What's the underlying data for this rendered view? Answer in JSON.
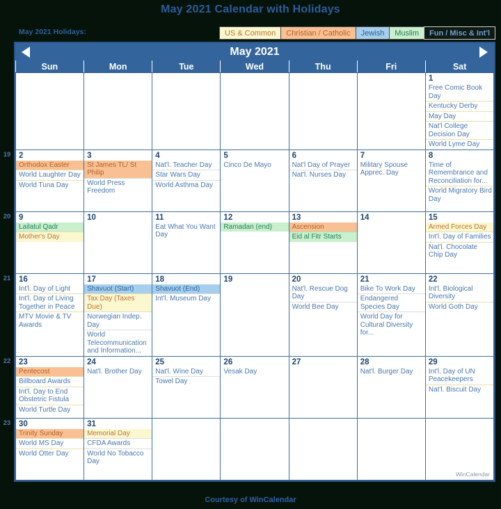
{
  "page": {
    "title": "May 2021 Calendar with Holidays",
    "footer_prefix": "Courtesy of ",
    "footer_brand": "WinCalendar",
    "watermark": "WinCalendar"
  },
  "legend": {
    "label": "May 2021 Holidays:",
    "categories": [
      {
        "id": "us",
        "label": "US & Common",
        "bg": "#fbf8cf",
        "fg": "#c2703a"
      },
      {
        "id": "chr",
        "label": "Christian / Catholic",
        "bg": "#f9c193",
        "fg": "#b35f28"
      },
      {
        "id": "jew",
        "label": "Jewish",
        "bg": "#a6cfee",
        "fg": "#2b5f96"
      },
      {
        "id": "mus",
        "label": "Muslim",
        "bg": "#c9efcd",
        "fg": "#23805b"
      },
      {
        "id": "fun",
        "label": "Fun / Misc & Int'l",
        "bg": "#0f1a12",
        "fg": "#6f9fd4"
      }
    ]
  },
  "calendar": {
    "month_title": "May 2021",
    "prev_label": "Previous month",
    "next_label": "Next month",
    "weekdays": [
      "Sun",
      "Mon",
      "Tue",
      "Wed",
      "Thu",
      "Fri",
      "Sat"
    ],
    "week_numbers": [
      "19",
      "20",
      "21",
      "22",
      "23"
    ],
    "weeks": [
      [
        {
          "day": null
        },
        {
          "day": null
        },
        {
          "day": null
        },
        {
          "day": null
        },
        {
          "day": null
        },
        {
          "day": null
        },
        {
          "day": "1",
          "tint": "us",
          "events": [
            {
              "text": "Free Comic Book Day",
              "cat": ""
            },
            {
              "text": "Kentucky Derby",
              "cat": ""
            },
            {
              "text": "May Day",
              "cat": ""
            },
            {
              "text": "Nat'l College Decision Day",
              "cat": ""
            },
            {
              "text": "World Lyme Day",
              "cat": ""
            }
          ]
        }
      ],
      [
        {
          "day": "2",
          "tint": "us",
          "events": [
            {
              "text": "Orthodox Easter",
              "cat": "chr"
            },
            {
              "text": "World Laughter Day",
              "cat": ""
            },
            {
              "text": "World Tuna Day",
              "cat": ""
            }
          ]
        },
        {
          "day": "3",
          "events": [
            {
              "text": "St James TL/ St Philip",
              "cat": "chr"
            },
            {
              "text": "World Press Freedom",
              "cat": ""
            }
          ]
        },
        {
          "day": "4",
          "events": [
            {
              "text": "Nat'l. Teacher Day",
              "cat": ""
            },
            {
              "text": "Star Wars Day",
              "cat": ""
            },
            {
              "text": "World Asthma Day",
              "cat": ""
            }
          ]
        },
        {
          "day": "5",
          "events": [
            {
              "text": "Cinco De Mayo",
              "cat": ""
            }
          ]
        },
        {
          "day": "6",
          "events": [
            {
              "text": "Nat'l Day of Prayer",
              "cat": ""
            },
            {
              "text": "Nat'l. Nurses Day",
              "cat": ""
            }
          ]
        },
        {
          "day": "7",
          "events": [
            {
              "text": "Military Spouse Apprec. Day",
              "cat": ""
            }
          ]
        },
        {
          "day": "8",
          "tint": "us",
          "events": [
            {
              "text": "Time of Remembrance and Reconciliation for...",
              "cat": ""
            },
            {
              "text": "World Migratory Bird Day",
              "cat": ""
            }
          ]
        }
      ],
      [
        {
          "day": "9",
          "tint": "us",
          "events": [
            {
              "text": "Lailatul Qadr",
              "cat": "mus"
            },
            {
              "text": "Mother's Day",
              "cat": "us"
            }
          ]
        },
        {
          "day": "10",
          "events": []
        },
        {
          "day": "11",
          "events": [
            {
              "text": "Eat What You Want Day",
              "cat": ""
            }
          ]
        },
        {
          "day": "12",
          "events": [
            {
              "text": "Ramadan (end)",
              "cat": "mus"
            }
          ]
        },
        {
          "day": "13",
          "events": [
            {
              "text": "Ascension",
              "cat": "chr"
            },
            {
              "text": "Eid al Fitr Starts",
              "cat": "mus"
            }
          ]
        },
        {
          "day": "14",
          "events": []
        },
        {
          "day": "15",
          "tint": "us",
          "events": [
            {
              "text": "Armed Forces Day",
              "cat": "us"
            },
            {
              "text": "Int'l. Day of Families",
              "cat": ""
            },
            {
              "text": "Nat'l. Chocolate Chip Day",
              "cat": ""
            }
          ]
        }
      ],
      [
        {
          "day": "16",
          "tint": "us",
          "events": [
            {
              "text": "Int'l. Day of Light",
              "cat": ""
            },
            {
              "text": "Int'l. Day of Living Together in Peace",
              "cat": ""
            },
            {
              "text": "MTV Movie & TV Awards",
              "cat": ""
            }
          ]
        },
        {
          "day": "17",
          "events": [
            {
              "text": "Shavuot (Start)",
              "cat": "jew"
            },
            {
              "text": "Tax Day (Taxes Due)",
              "cat": "us"
            },
            {
              "text": "Norwegian Indep. Day",
              "cat": ""
            },
            {
              "text": "World Telecommunication and Information...",
              "cat": ""
            }
          ]
        },
        {
          "day": "18",
          "events": [
            {
              "text": "Shavuot (End)",
              "cat": "jew"
            },
            {
              "text": "Int'l. Museum Day",
              "cat": ""
            }
          ]
        },
        {
          "day": "19",
          "events": []
        },
        {
          "day": "20",
          "events": [
            {
              "text": "Nat'l. Rescue Dog Day",
              "cat": ""
            },
            {
              "text": "World Bee Day",
              "cat": ""
            }
          ]
        },
        {
          "day": "21",
          "events": [
            {
              "text": "Bike To Work Day",
              "cat": ""
            },
            {
              "text": "Endangered Species Day",
              "cat": ""
            },
            {
              "text": "World Day for Cultural Diversity for...",
              "cat": ""
            }
          ]
        },
        {
          "day": "22",
          "tint": "us",
          "events": [
            {
              "text": "Int'l. Biological Diversity",
              "cat": ""
            },
            {
              "text": "World Goth Day",
              "cat": ""
            }
          ]
        }
      ],
      [
        {
          "day": "23",
          "tint": "us",
          "events": [
            {
              "text": "Pentecost",
              "cat": "chr"
            },
            {
              "text": "Billboard Awards",
              "cat": ""
            },
            {
              "text": "Int'l. Day to End Obstetric Fistula",
              "cat": ""
            },
            {
              "text": "World Turtle Day",
              "cat": ""
            }
          ]
        },
        {
          "day": "24",
          "events": [
            {
              "text": "Nat'l. Brother Day",
              "cat": ""
            }
          ]
        },
        {
          "day": "25",
          "events": [
            {
              "text": "Nat'l. Wine Day",
              "cat": ""
            },
            {
              "text": "Towel Day",
              "cat": ""
            }
          ]
        },
        {
          "day": "26",
          "events": [
            {
              "text": "Vesak Day",
              "cat": ""
            }
          ]
        },
        {
          "day": "27",
          "events": []
        },
        {
          "day": "28",
          "events": [
            {
              "text": "Nat'l. Burger Day",
              "cat": ""
            }
          ]
        },
        {
          "day": "29",
          "tint": "us",
          "events": [
            {
              "text": "Int'l. Day of UN Peacekeepers",
              "cat": ""
            },
            {
              "text": "Nat'l. Biscuit Day",
              "cat": ""
            }
          ]
        }
      ],
      [
        {
          "day": "30",
          "tint": "us",
          "events": [
            {
              "text": "Trinity Sunday",
              "cat": "chr"
            },
            {
              "text": "World MS Day",
              "cat": ""
            },
            {
              "text": "World Otter Day",
              "cat": ""
            }
          ]
        },
        {
          "day": "31",
          "events": [
            {
              "text": "Memorial Day",
              "cat": "us"
            },
            {
              "text": "CFDA Awards",
              "cat": ""
            },
            {
              "text": "World No Tobacco Day",
              "cat": ""
            }
          ]
        },
        {
          "day": null
        },
        {
          "day": null
        },
        {
          "day": null
        },
        {
          "day": null
        },
        {
          "day": null
        }
      ]
    ]
  }
}
